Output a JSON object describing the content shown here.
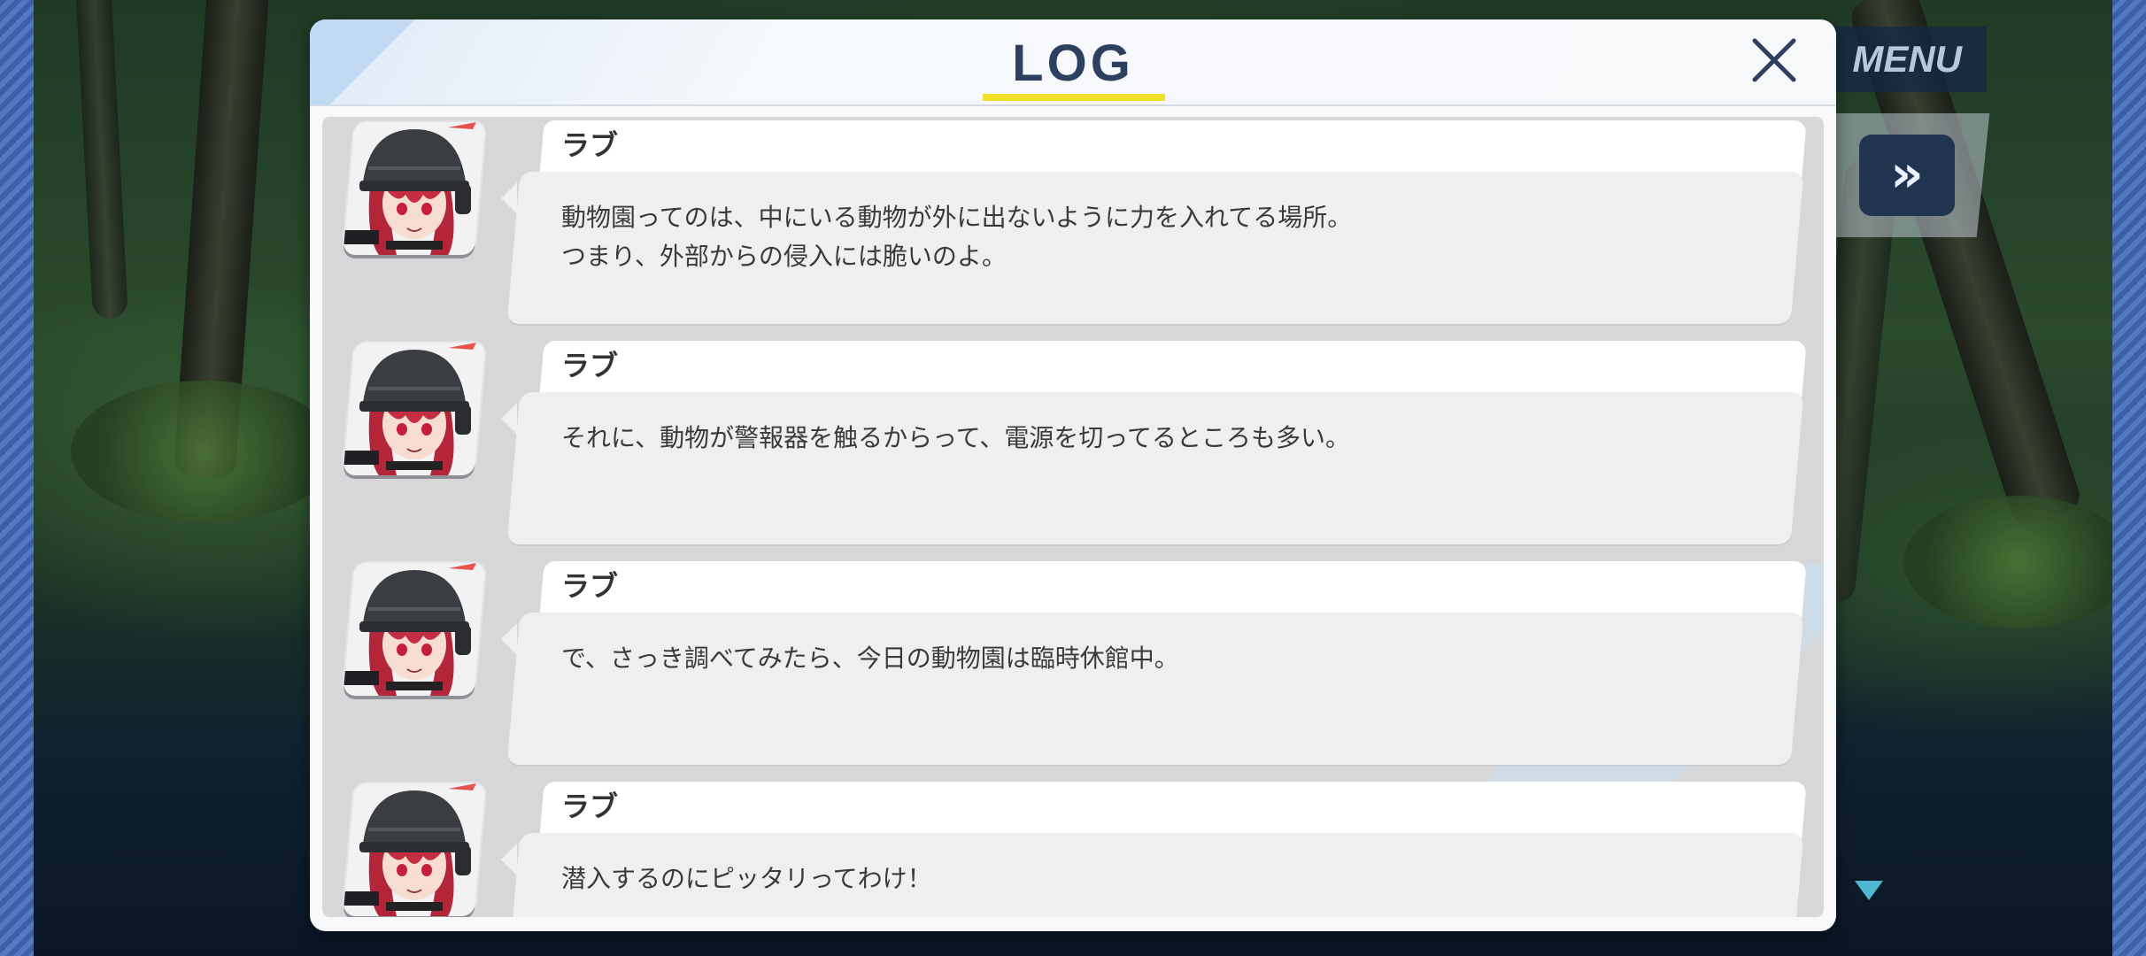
{
  "hud": {
    "menu_label": "MENU",
    "fast_forward_glyph": "»"
  },
  "log": {
    "title": "LOG",
    "close_glyph": "close-icon",
    "accent_color": "#f2e12a",
    "entries": [
      {
        "speaker": "ラブ",
        "text": "動物園ってのは、中にいる動物が外に出ないように力を入れてる場所。\nつまり、外部からの侵入には脆いのよ。"
      },
      {
        "speaker": "ラブ",
        "text": "それに、動物が警報器を触るからって、電源を切ってるところも多い。"
      },
      {
        "speaker": "ラブ",
        "text": "で、さっき調べてみたら、今日の動物園は臨時休館中。"
      },
      {
        "speaker": "ラブ",
        "text": "潜入するのにピッタリってわけ！"
      }
    ]
  }
}
